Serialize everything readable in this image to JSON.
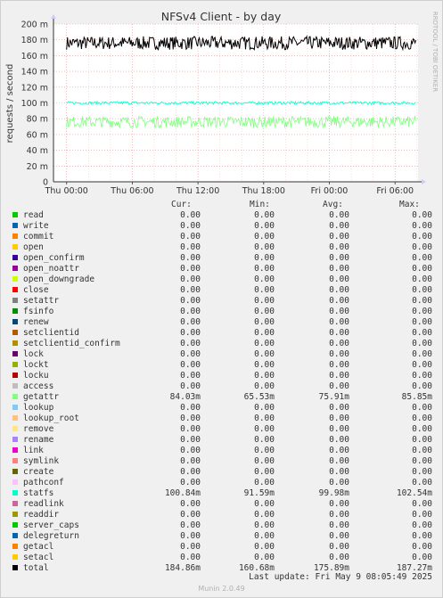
{
  "colors": {
    "background": "#f0f0f0",
    "plot_bg": "#ffffff",
    "grid": "#e8a0a0",
    "axis": "#333333"
  },
  "side_label": "RRDTOOL / TOBI OETIKER",
  "legend": {
    "headers": {
      "cur": "Cur:",
      "min": "Min:",
      "avg": "Avg:",
      "max": "Max:"
    },
    "rows": [
      {
        "name": "read",
        "color": "#00cc00",
        "cur": "0.00",
        "min": "0.00",
        "avg": "0.00",
        "max": "0.00"
      },
      {
        "name": "write",
        "color": "#0066b3",
        "cur": "0.00",
        "min": "0.00",
        "avg": "0.00",
        "max": "0.00"
      },
      {
        "name": "commit",
        "color": "#ff8000",
        "cur": "0.00",
        "min": "0.00",
        "avg": "0.00",
        "max": "0.00"
      },
      {
        "name": "open",
        "color": "#ffcc00",
        "cur": "0.00",
        "min": "0.00",
        "avg": "0.00",
        "max": "0.00"
      },
      {
        "name": "open_confirm",
        "color": "#330099",
        "cur": "0.00",
        "min": "0.00",
        "avg": "0.00",
        "max": "0.00"
      },
      {
        "name": "open_noattr",
        "color": "#990099",
        "cur": "0.00",
        "min": "0.00",
        "avg": "0.00",
        "max": "0.00"
      },
      {
        "name": "open_downgrade",
        "color": "#ccff00",
        "cur": "0.00",
        "min": "0.00",
        "avg": "0.00",
        "max": "0.00"
      },
      {
        "name": "close",
        "color": "#ff0000",
        "cur": "0.00",
        "min": "0.00",
        "avg": "0.00",
        "max": "0.00"
      },
      {
        "name": "setattr",
        "color": "#808080",
        "cur": "0.00",
        "min": "0.00",
        "avg": "0.00",
        "max": "0.00"
      },
      {
        "name": "fsinfo",
        "color": "#008f00",
        "cur": "0.00",
        "min": "0.00",
        "avg": "0.00",
        "max": "0.00"
      },
      {
        "name": "renew",
        "color": "#00487d",
        "cur": "0.00",
        "min": "0.00",
        "avg": "0.00",
        "max": "0.00"
      },
      {
        "name": "setclientid",
        "color": "#b35a00",
        "cur": "0.00",
        "min": "0.00",
        "avg": "0.00",
        "max": "0.00"
      },
      {
        "name": "setclientid_confirm",
        "color": "#b38f00",
        "cur": "0.00",
        "min": "0.00",
        "avg": "0.00",
        "max": "0.00"
      },
      {
        "name": "lock",
        "color": "#6b006b",
        "cur": "0.00",
        "min": "0.00",
        "avg": "0.00",
        "max": "0.00"
      },
      {
        "name": "lockt",
        "color": "#8fb300",
        "cur": "0.00",
        "min": "0.00",
        "avg": "0.00",
        "max": "0.00"
      },
      {
        "name": "locku",
        "color": "#b30000",
        "cur": "0.00",
        "min": "0.00",
        "avg": "0.00",
        "max": "0.00"
      },
      {
        "name": "access",
        "color": "#bebebe",
        "cur": "0.00",
        "min": "0.00",
        "avg": "0.00",
        "max": "0.00"
      },
      {
        "name": "getattr",
        "color": "#80ff80",
        "cur": "84.03m",
        "min": "65.53m",
        "avg": "75.91m",
        "max": "85.85m"
      },
      {
        "name": "lookup",
        "color": "#80c9ff",
        "cur": "0.00",
        "min": "0.00",
        "avg": "0.00",
        "max": "0.00"
      },
      {
        "name": "lookup_root",
        "color": "#ffc080",
        "cur": "0.00",
        "min": "0.00",
        "avg": "0.00",
        "max": "0.00"
      },
      {
        "name": "remove",
        "color": "#ffe680",
        "cur": "0.00",
        "min": "0.00",
        "avg": "0.00",
        "max": "0.00"
      },
      {
        "name": "rename",
        "color": "#aa80ff",
        "cur": "0.00",
        "min": "0.00",
        "avg": "0.00",
        "max": "0.00"
      },
      {
        "name": "link",
        "color": "#ee00cc",
        "cur": "0.00",
        "min": "0.00",
        "avg": "0.00",
        "max": "0.00"
      },
      {
        "name": "symlink",
        "color": "#ff8080",
        "cur": "0.00",
        "min": "0.00",
        "avg": "0.00",
        "max": "0.00"
      },
      {
        "name": "create",
        "color": "#666600",
        "cur": "0.00",
        "min": "0.00",
        "avg": "0.00",
        "max": "0.00"
      },
      {
        "name": "pathconf",
        "color": "#ffbfff",
        "cur": "0.00",
        "min": "0.00",
        "avg": "0.00",
        "max": "0.00"
      },
      {
        "name": "statfs",
        "color": "#00ffcc",
        "cur": "100.84m",
        "min": "91.59m",
        "avg": "99.98m",
        "max": "102.54m"
      },
      {
        "name": "readlink",
        "color": "#cc6699",
        "cur": "0.00",
        "min": "0.00",
        "avg": "0.00",
        "max": "0.00"
      },
      {
        "name": "readdir",
        "color": "#999900",
        "cur": "0.00",
        "min": "0.00",
        "avg": "0.00",
        "max": "0.00"
      },
      {
        "name": "server_caps",
        "color": "#00cc00",
        "cur": "0.00",
        "min": "0.00",
        "avg": "0.00",
        "max": "0.00"
      },
      {
        "name": "delegreturn",
        "color": "#0066b3",
        "cur": "0.00",
        "min": "0.00",
        "avg": "0.00",
        "max": "0.00"
      },
      {
        "name": "getacl",
        "color": "#ff8000",
        "cur": "0.00",
        "min": "0.00",
        "avg": "0.00",
        "max": "0.00"
      },
      {
        "name": "setacl",
        "color": "#ffcc00",
        "cur": "0.00",
        "min": "0.00",
        "avg": "0.00",
        "max": "0.00"
      },
      {
        "name": "total",
        "color": "#000000",
        "cur": "184.86m",
        "min": "160.68m",
        "avg": "175.89m",
        "max": "187.27m"
      }
    ]
  },
  "last_update": "Last update: Fri May  9 08:05:49 2025",
  "footer": "Munin 2.0.49",
  "chart_data": {
    "type": "line",
    "title": "NFSv4 Client - by day",
    "xlabel": "",
    "ylabel": "requests / second",
    "ylim": [
      0,
      200
    ],
    "y_ticks": [
      {
        "value": 0,
        "label": "0"
      },
      {
        "value": 20,
        "label": "20 m"
      },
      {
        "value": 40,
        "label": "40 m"
      },
      {
        "value": 60,
        "label": "60 m"
      },
      {
        "value": 80,
        "label": "80 m"
      },
      {
        "value": 100,
        "label": "100 m"
      },
      {
        "value": 120,
        "label": "120 m"
      },
      {
        "value": 140,
        "label": "140 m"
      },
      {
        "value": 160,
        "label": "160 m"
      },
      {
        "value": 180,
        "label": "180 m"
      },
      {
        "value": 200,
        "label": "200 m"
      }
    ],
    "x_range_hours": [
      -1.2,
      32.1
    ],
    "x_ticks": [
      {
        "hour": 0,
        "label": "Thu 00:00"
      },
      {
        "hour": 6,
        "label": "Thu 06:00"
      },
      {
        "hour": 12,
        "label": "Thu 12:00"
      },
      {
        "hour": 18,
        "label": "Thu 18:00"
      },
      {
        "hour": 24,
        "label": "Fri 00:00"
      },
      {
        "hour": 30,
        "label": "Fri 06:00"
      }
    ],
    "grid": true,
    "series": [
      {
        "name": "total",
        "color": "#000000",
        "approx_level": 176,
        "range": [
          160.68,
          187.27
        ]
      },
      {
        "name": "statfs",
        "color": "#00ffcc",
        "approx_level": 100,
        "range": [
          91.59,
          102.54
        ]
      },
      {
        "name": "getattr",
        "color": "#80ff80",
        "approx_level": 76,
        "range": [
          65.53,
          85.85
        ]
      }
    ]
  }
}
